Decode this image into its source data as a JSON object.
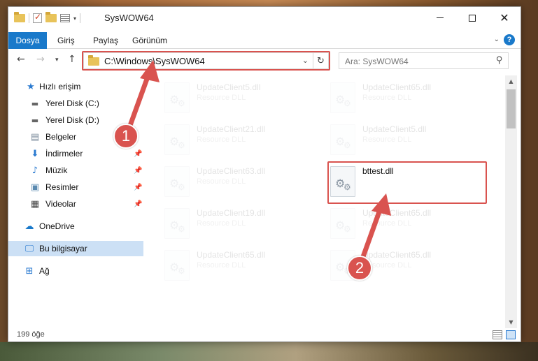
{
  "window": {
    "title": "SysWOW64"
  },
  "ribbon": {
    "tabs": [
      "Dosya",
      "Giriş",
      "Paylaş",
      "Görünüm"
    ]
  },
  "navbar": {
    "address": "C:\\Windows\\SysWOW64",
    "search_placeholder": "Ara: SysWOW64"
  },
  "sidebar": {
    "items": [
      {
        "label": "Hızlı erişim",
        "icon": "star-icon"
      },
      {
        "label": "Yerel Disk (C:)",
        "icon": "drive-icon"
      },
      {
        "label": "Yerel Disk (D:)",
        "icon": "drive-icon"
      },
      {
        "label": "Belgeler",
        "icon": "documents-icon"
      },
      {
        "label": "İndirmeler",
        "icon": "download-icon"
      },
      {
        "label": "Müzik",
        "icon": "music-icon"
      },
      {
        "label": "Resimler",
        "icon": "pictures-icon"
      },
      {
        "label": "Videolar",
        "icon": "video-icon"
      },
      {
        "label": "OneDrive",
        "icon": "cloud-icon"
      },
      {
        "label": "Bu bilgisayar",
        "icon": "computer-icon"
      },
      {
        "label": "Ağ",
        "icon": "network-icon"
      }
    ],
    "selected": "Bu bilgisayar"
  },
  "files": [
    {
      "name": "UpdateClient5.dll",
      "type": "Resource DLL"
    },
    {
      "name": "UpdateClient65.dll",
      "type": "Resource DLL"
    },
    {
      "name": "UpdateClient21.dll",
      "type": "Resource DLL"
    },
    {
      "name": "UpdateClient5.dll",
      "type": "Resource DLL"
    },
    {
      "name": "UpdateClient63.dll",
      "type": "Resource DLL"
    },
    {
      "name": "bttest.dll",
      "type": ""
    },
    {
      "name": "UpdateClient19.dll",
      "type": "Resource DLL"
    },
    {
      "name": "UpdateClient65.dll",
      "type": "Resource DLL"
    },
    {
      "name": "UpdateClient65.dll",
      "type": "Resource DLL"
    },
    {
      "name": "UpdateClient65.dll",
      "type": "Resource DLL"
    }
  ],
  "status": {
    "count": "199 öğe"
  },
  "annotations": {
    "step1": "1",
    "step2": "2",
    "highlight_color": "#d9534f"
  },
  "colors": {
    "accent": "#1979ca",
    "selection": "#cce0f5"
  }
}
